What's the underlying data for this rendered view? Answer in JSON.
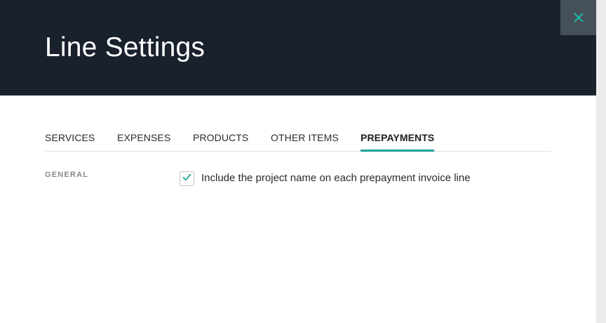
{
  "dialog": {
    "title": "Line Settings",
    "close_icon": "close-icon"
  },
  "tabs": [
    {
      "label": "SERVICES",
      "active": false
    },
    {
      "label": "EXPENSES",
      "active": false
    },
    {
      "label": "PRODUCTS",
      "active": false
    },
    {
      "label": "OTHER ITEMS",
      "active": false
    },
    {
      "label": "PREPAYMENTS",
      "active": true
    }
  ],
  "section": {
    "label": "GENERAL",
    "option": {
      "label": "Include the project name on each prepayment invoice line",
      "checked": true
    }
  },
  "colors": {
    "header_bg": "#18212c",
    "accent": "#1fa595",
    "close_bg": "#46505b"
  }
}
